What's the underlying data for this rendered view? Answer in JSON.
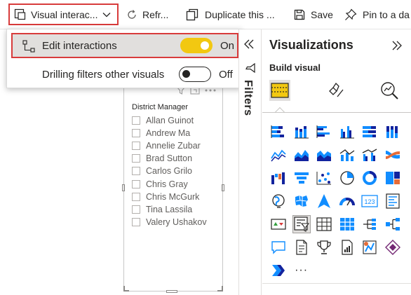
{
  "toolbar": {
    "visual_interactions": "Visual interac...",
    "refresh": "Refr...",
    "duplicate": "Duplicate this ...",
    "save": "Save",
    "pin": "Pin to a da"
  },
  "dropdown": {
    "edit_interactions": {
      "label": "Edit interactions",
      "state": "On"
    },
    "drilling_filters": {
      "label": "Drilling filters other visuals",
      "state": "Off"
    }
  },
  "slicer": {
    "title": "District Manager",
    "items": [
      "Allan Guinot",
      "Andrew Ma",
      "Annelie Zubar",
      "Brad Sutton",
      "Carlos Grilo",
      "Chris Gray",
      "Chris McGurk",
      "Tina Lassila",
      "Valery Ushakov"
    ]
  },
  "filters_pane": {
    "label": "Filters"
  },
  "visualizations": {
    "title": "Visualizations",
    "subtitle": "Build visual",
    "more": "···",
    "accent_colors": {
      "blue": "#118dff",
      "navy": "#12239e",
      "orange": "#e66c37",
      "toggle_yellow": "#f2c811",
      "highlight_red": "#d83b3b"
    }
  }
}
